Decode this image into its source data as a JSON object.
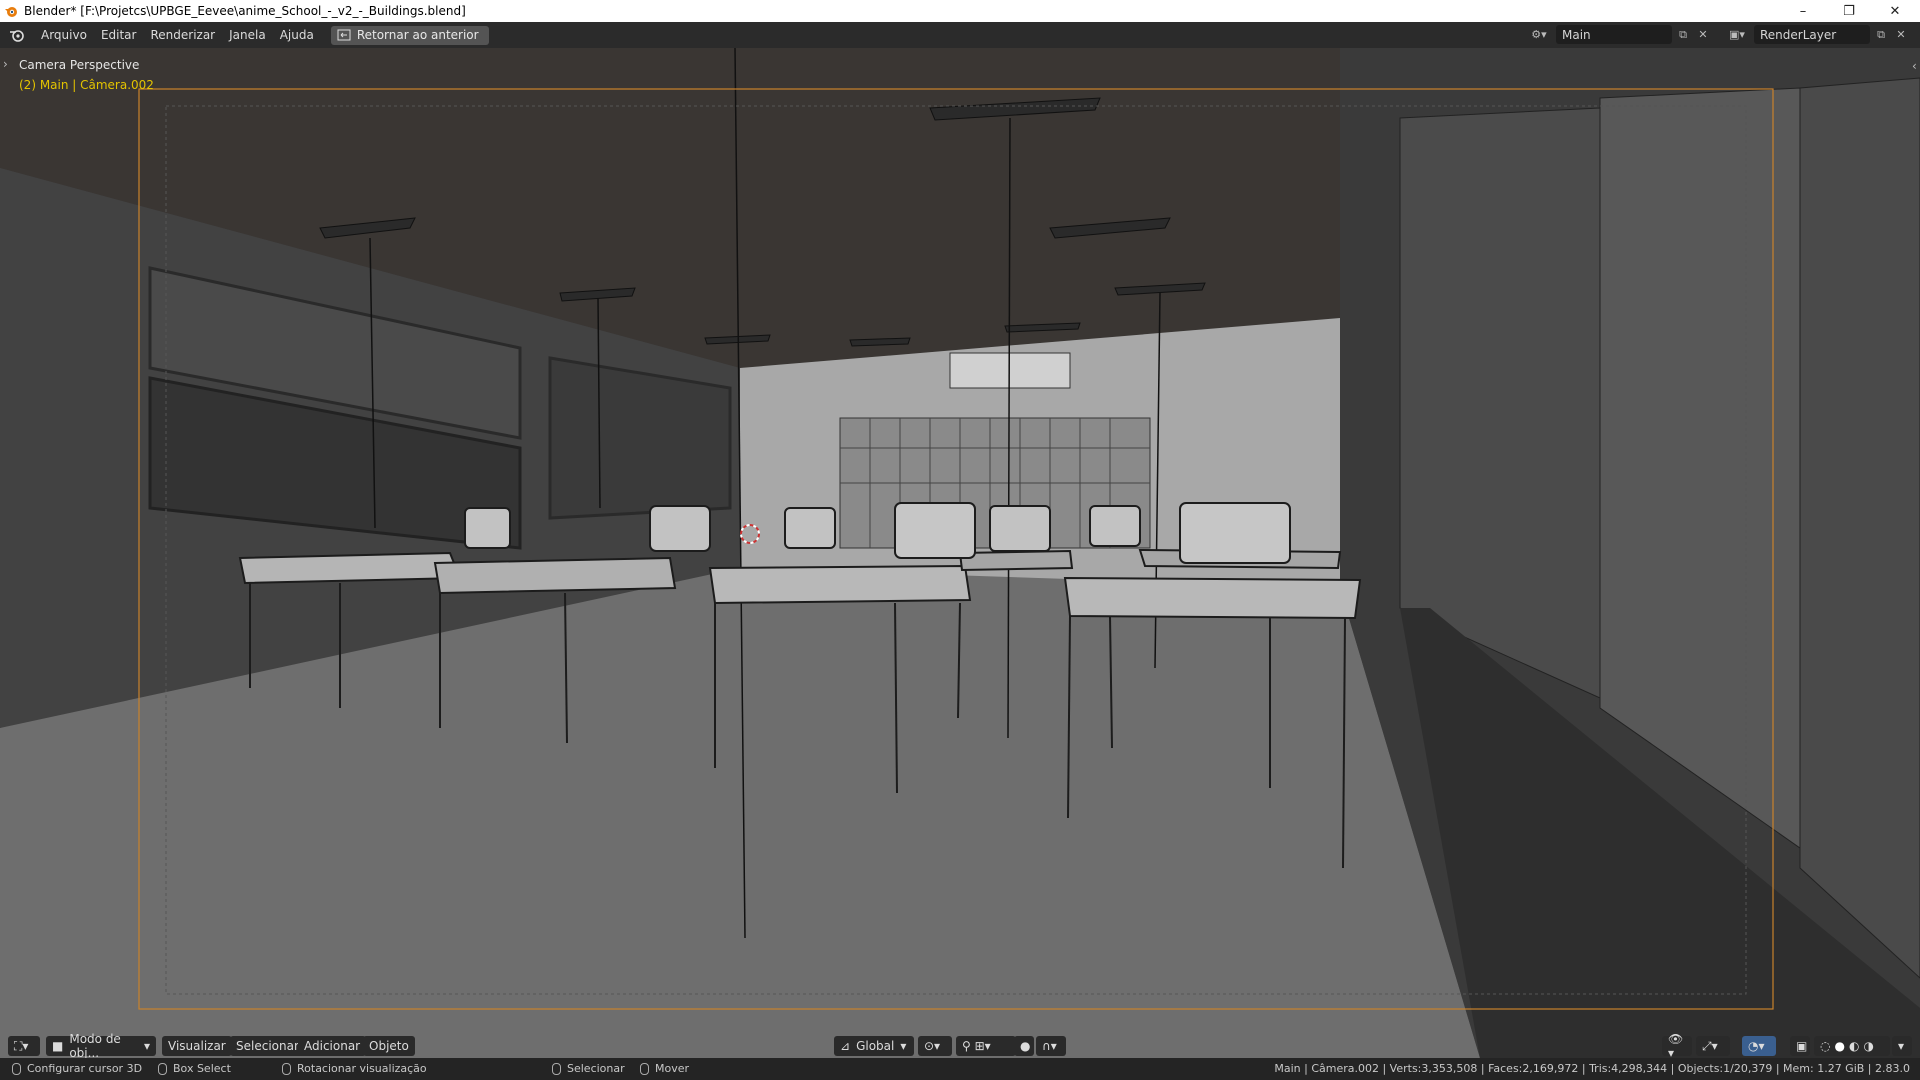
{
  "window": {
    "title": "Blender* [F:\\Projetcs\\UPBGE_Eevee\\anime_School_-_v2_-_Buildings.blend]",
    "minimize": "–",
    "maximize": "❐",
    "close": "✕"
  },
  "topbar": {
    "menus": [
      "Arquivo",
      "Editar",
      "Renderizar",
      "Janela",
      "Ajuda"
    ],
    "back_button": "Retornar ao anterior",
    "scene_name": "Main",
    "view_layer": "RenderLayer"
  },
  "viewport": {
    "camera_label": "Camera Perspective",
    "camera_sub": "(2) Main | Câmera.002",
    "colors": {
      "camera_frame": "#c9822c",
      "sub_text": "#e3c300"
    }
  },
  "header": {
    "mode": "Modo de obj...",
    "menus": [
      "Visualizar",
      "Selecionar",
      "Adicionar",
      "Objeto"
    ],
    "orientation": "Global"
  },
  "status": {
    "left": [
      {
        "icon": "mouse-left-icon",
        "label": "Configurar cursor 3D"
      },
      {
        "icon": "mouse-middle-icon",
        "label": "Box Select"
      },
      {
        "icon": "mouse-right-icon",
        "label": "Rotacionar visualização"
      },
      {
        "icon": "mouse-left-icon",
        "label": "Selecionar"
      },
      {
        "icon": "mouse-right-icon",
        "label": "Mover"
      }
    ],
    "stats": "Main | Câmera.002 | Verts:3,353,508 | Faces:2,169,972 | Tris:4,298,344 | Objects:1/20,379 | Mem: 1.27 GiB | 2.83.0"
  }
}
